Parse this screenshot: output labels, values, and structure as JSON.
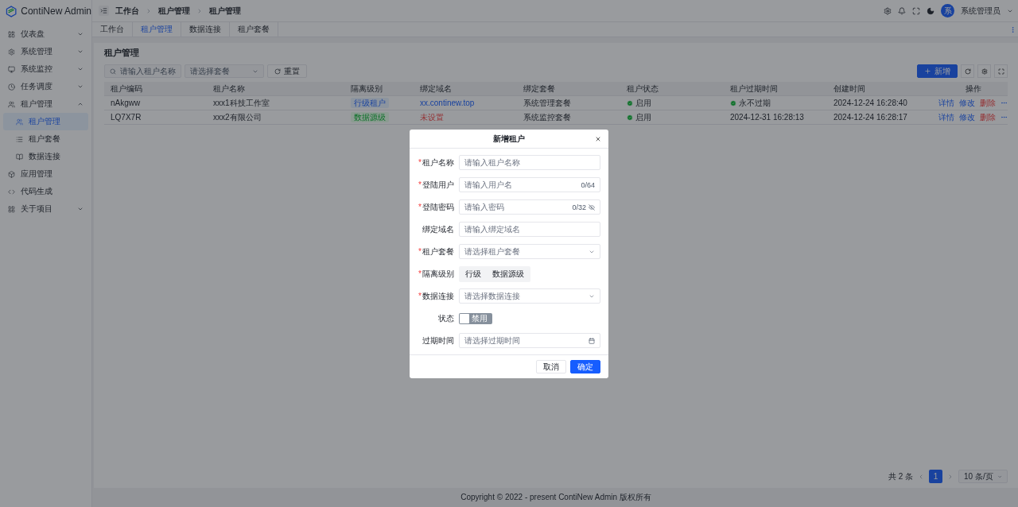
{
  "app": {
    "name": "ContiNew Admin"
  },
  "breadcrumb": [
    "工作台",
    "租户管理",
    "租户管理"
  ],
  "header": {
    "user": "系统管理员",
    "avatar": "系"
  },
  "sidebar": {
    "items": [
      {
        "label": "仪表盘",
        "expanded": false,
        "selected": false
      },
      {
        "label": "系统管理",
        "expanded": false,
        "selected": false
      },
      {
        "label": "系统监控",
        "expanded": false,
        "selected": false
      },
      {
        "label": "任务调度",
        "expanded": false,
        "selected": false
      },
      {
        "label": "租户管理",
        "expanded": true,
        "selected": false,
        "children": [
          {
            "label": "租户管理",
            "selected": true
          },
          {
            "label": "租户套餐",
            "selected": false
          },
          {
            "label": "数据连接",
            "selected": false
          }
        ]
      },
      {
        "label": "应用管理",
        "selected": false
      },
      {
        "label": "代码生成",
        "selected": false
      },
      {
        "label": "关于项目",
        "expanded": false,
        "selected": false
      }
    ]
  },
  "tabs": [
    {
      "label": "工作台",
      "selected": false
    },
    {
      "label": "租户管理",
      "selected": true
    },
    {
      "label": "数据连接",
      "selected": false
    },
    {
      "label": "租户套餐",
      "selected": false
    }
  ],
  "page": {
    "title": "租户管理",
    "search": {
      "placeholder": "请输入租户名称"
    },
    "package_select": {
      "placeholder": "请选择套餐"
    },
    "reset_button": "重置",
    "add_button": "新增",
    "table": {
      "columns": [
        "租户编码",
        "租户名称",
        "隔离级别",
        "绑定域名",
        "绑定套餐",
        "租户状态",
        "租户过期时间",
        "创建时间",
        "操作"
      ],
      "rows": [
        {
          "code": "nAkgww",
          "name": "xxx1科技工作室",
          "level": {
            "text": "行级租户",
            "kind": "row"
          },
          "domain": {
            "text": "xx.continew.top",
            "set": true
          },
          "package": "系统管理套餐",
          "status": "启用",
          "expire": {
            "text": "永不过期",
            "forever": true
          },
          "created": "2024-12-24 16:28:40",
          "actions": [
            "详情",
            "修改",
            "删除"
          ]
        },
        {
          "code": "LQ7X7R",
          "name": "xxx2有限公司",
          "level": {
            "text": "数据源级",
            "kind": "datasource"
          },
          "domain": {
            "text": "未设置",
            "set": false
          },
          "package": "系统监控套餐",
          "status": "启用",
          "expire": {
            "text": "2024-12-31 16:28:13",
            "forever": false
          },
          "created": "2024-12-24 16:28:17",
          "actions": [
            "详情",
            "修改",
            "删除"
          ]
        }
      ]
    },
    "pagination": {
      "total": "共 2 条",
      "pages": [
        {
          "label": "1",
          "selected": true
        }
      ],
      "page_size": "10 条/页"
    }
  },
  "footer": "Copyright © 2022 - present ContiNew Admin 版权所有",
  "modal": {
    "title": "新增租户",
    "required_mark": "*",
    "fields": [
      {
        "kind": "input",
        "label": "租户名称",
        "required": true,
        "placeholder": "请输入租户名称"
      },
      {
        "kind": "input",
        "label": "登陆用户",
        "required": true,
        "placeholder": "请输入用户名",
        "counter": "0/64"
      },
      {
        "kind": "password",
        "label": "登陆密码",
        "required": true,
        "placeholder": "请输入密码",
        "counter": "0/32"
      },
      {
        "kind": "input",
        "label": "绑定域名",
        "required": false,
        "placeholder": "请输入绑定域名"
      },
      {
        "kind": "select",
        "label": "租户套餐",
        "required": true,
        "placeholder": "请选择租户套餐"
      },
      {
        "kind": "radio",
        "label": "隔离级别",
        "required": true,
        "options": [
          {
            "label": "行级",
            "selected": false
          },
          {
            "label": "数据源级",
            "selected": false
          }
        ]
      },
      {
        "kind": "select",
        "label": "数据连接",
        "required": true,
        "placeholder": "请选择数据连接"
      },
      {
        "kind": "switch",
        "label": "状态",
        "required": false,
        "on": false,
        "text": "禁用"
      },
      {
        "kind": "date",
        "label": "过期时间",
        "required": false,
        "placeholder": "请选择过期时间"
      }
    ],
    "buttons": {
      "cancel": "取消",
      "ok": "确定"
    }
  }
}
